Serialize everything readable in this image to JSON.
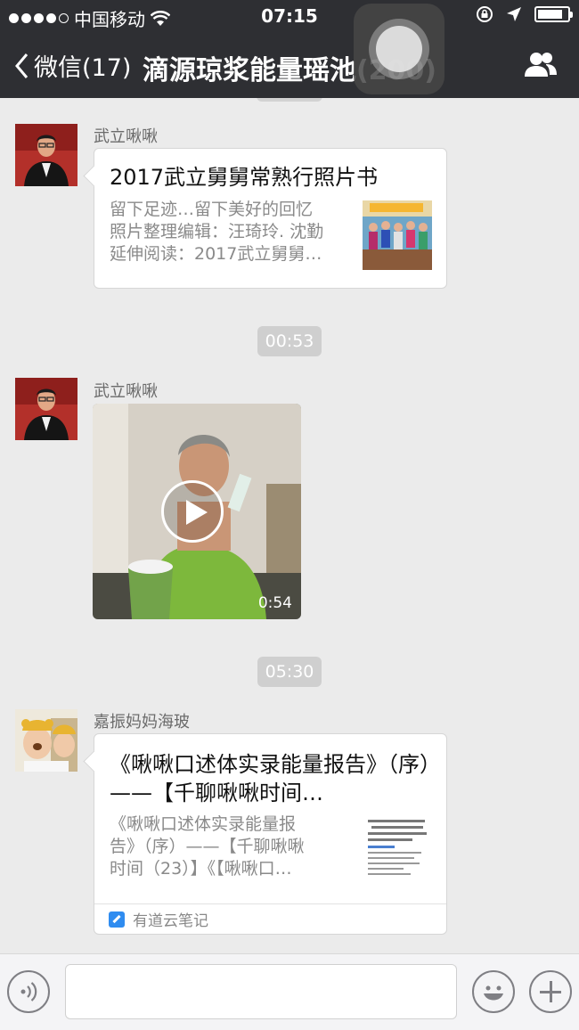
{
  "status_bar": {
    "carrier": "中国移动",
    "time": "07:15",
    "battery_level": 0.85
  },
  "nav": {
    "back_label": "微信(17)",
    "title": "滴源琼浆能量瑶池(200)",
    "group_icon": "group-members-icon"
  },
  "messages": [
    {
      "sender": "武立啾啾",
      "type": "link-card",
      "title": "2017武立舅舅常熟行照片书",
      "desc_lines": [
        "留下足迹…留下美好的回忆",
        "照片整理编辑：汪琦玲. 沈勤",
        "延伸阅读：2017武立舅舅…"
      ]
    },
    {
      "timestamp": "00:53"
    },
    {
      "sender": "武立啾啾",
      "type": "video",
      "duration": "0:54"
    },
    {
      "timestamp": "05:30"
    },
    {
      "sender": "嘉振妈妈海玻",
      "type": "link-card",
      "title": "《啾啾口述体实录能量报告》（序）——【千聊啾啾时间…",
      "desc_lines": [
        "《啾啾口述体实录能量报",
        "告》（序）——【千聊啾啾",
        "时间（23）】《【啾啾口…"
      ],
      "source": "有道云笔记"
    }
  ],
  "input": {
    "placeholder": ""
  },
  "colors": {
    "header_bg": "#2e2f33",
    "chat_bg": "#ebebeb",
    "timestamp_bg": "#cfcfcf",
    "youdao_blue": "#2f8cf0"
  }
}
